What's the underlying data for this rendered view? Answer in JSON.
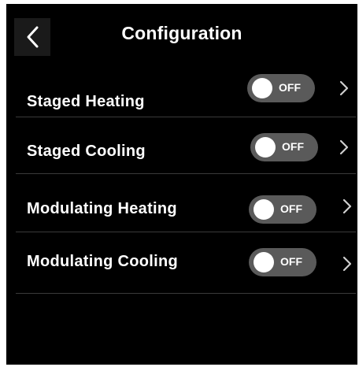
{
  "header": {
    "title": "Configuration",
    "back_icon": "chevron-left-icon"
  },
  "settings": [
    {
      "label": "Staged Heating",
      "toggle_state": "OFF",
      "icon": "chevron-right-icon"
    },
    {
      "label": "Staged Cooling",
      "toggle_state": "OFF",
      "icon": "chevron-right-icon"
    },
    {
      "label": "Modulating Heating",
      "toggle_state": "OFF",
      "icon": "chevron-right-icon"
    },
    {
      "label": "Modulating Cooling",
      "toggle_state": "OFF",
      "icon": "chevron-right-icon"
    }
  ],
  "colors": {
    "background": "#000000",
    "text": "#ffffff",
    "toggle_off": "#5a5a5a",
    "divider": "#3a3a3a"
  }
}
